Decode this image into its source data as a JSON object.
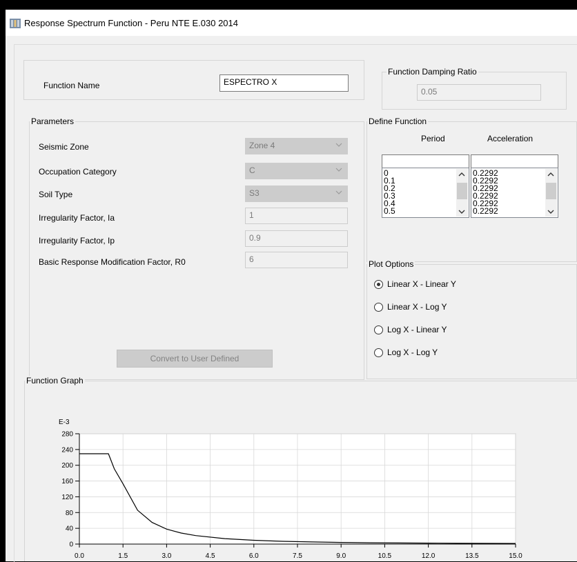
{
  "window": {
    "title": "Response Spectrum Function - Peru NTE E.030 2014"
  },
  "function_name": {
    "label": "Function Name",
    "value": "ESPECTRO X"
  },
  "damping": {
    "legend": "Function Damping Ratio",
    "value": "0.05"
  },
  "parameters": {
    "legend": "Parameters",
    "seismic_zone": {
      "label": "Seismic Zone",
      "value": "Zone 4"
    },
    "occupation_category": {
      "label": "Occupation Category",
      "value": "C"
    },
    "soil_type": {
      "label": "Soil Type",
      "value": "S3"
    },
    "irregularity_ia": {
      "label": "Irregularity Factor, Ia",
      "value": "1"
    },
    "irregularity_ip": {
      "label": "Irregularity Factor, Ip",
      "value": "0.9"
    },
    "r0": {
      "label": "Basic Response Modification Factor, R0",
      "value": "6"
    },
    "convert_button": "Convert to User Defined"
  },
  "define_function": {
    "legend": "Define Function",
    "period_header": "Period",
    "acceleration_header": "Acceleration",
    "periods": [
      "0",
      "0.1",
      "0.2",
      "0.3",
      "0.4",
      "0.5"
    ],
    "accelerations": [
      "0.2292",
      "0.2292",
      "0.2292",
      "0.2292",
      "0.2292",
      "0.2292"
    ]
  },
  "plot_options": {
    "legend": "Plot Options",
    "options": [
      "Linear X - Linear Y",
      "Linear X - Log Y",
      "Log X - Linear Y",
      "Log X - Log Y"
    ],
    "selected": "Linear X - Linear Y"
  },
  "graph": {
    "legend": "Function Graph"
  },
  "chart_data": {
    "type": "line",
    "title": "",
    "xlabel": "",
    "ylabel": "",
    "y_multiplier_label": "E-3",
    "xlim": [
      0,
      15
    ],
    "ylim": [
      0,
      280
    ],
    "x_ticks": [
      "0.0",
      "1.5",
      "3.0",
      "4.5",
      "6.0",
      "7.5",
      "9.0",
      "10.5",
      "12.0",
      "13.5",
      "15.0"
    ],
    "y_ticks": [
      "0",
      "40",
      "80",
      "120",
      "160",
      "200",
      "240",
      "280"
    ],
    "grid": true,
    "series": [
      {
        "x": [
          0,
          0.5,
          1.0,
          1.2,
          1.5,
          2.0,
          2.5,
          3.0,
          3.5,
          4.0,
          5.0,
          6.0,
          7.0,
          8.0,
          9.0,
          10.0,
          11.0,
          12.0,
          13.0,
          14.0,
          15.0
        ],
        "values": [
          229.2,
          229.2,
          229.2,
          191,
          153,
          86,
          55,
          38,
          28,
          21.5,
          13.8,
          9.6,
          7.0,
          5.4,
          4.2,
          3.4,
          2.8,
          2.4,
          2.0,
          1.8,
          1.5
        ]
      }
    ]
  },
  "icons": {
    "app": "structure-icon"
  },
  "colors": {
    "plot_line": "#000000",
    "grid": "#d8d8d8"
  }
}
